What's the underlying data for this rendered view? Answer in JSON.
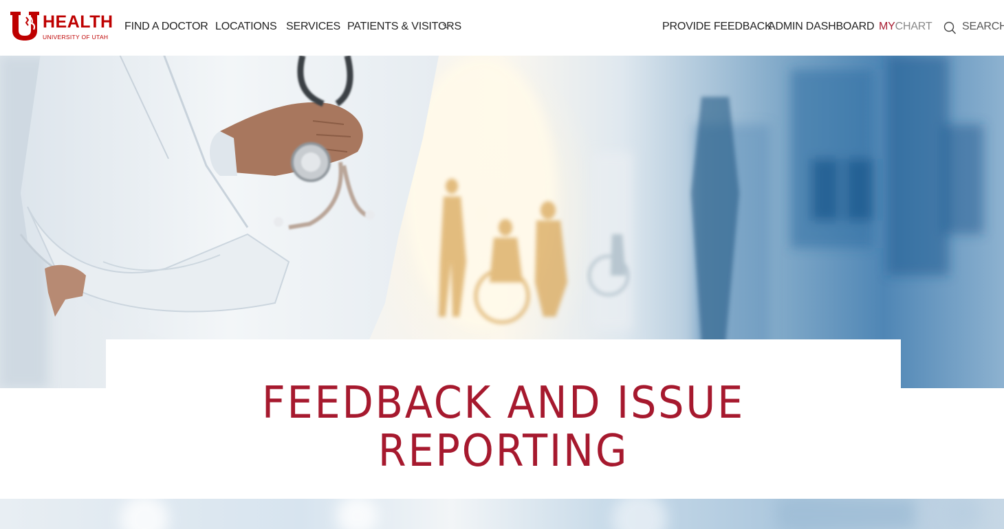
{
  "logo": {
    "brand": "HEALTH",
    "subtitle": "UNIVERSITY OF UTAH",
    "brand_color": "#be0000"
  },
  "nav": {
    "primary": [
      {
        "label": "FIND A DOCTOR"
      },
      {
        "label": "LOCATIONS"
      },
      {
        "label": "SERVICES"
      },
      {
        "label": "PATIENTS & VISITORS",
        "icon": "chevron-down-icon"
      }
    ],
    "secondary": {
      "feedback": "PROVIDE FEEDBACK",
      "admin": "ADMIN DASHBOARD",
      "mychart_my": "MY",
      "mychart_chart": "CHART",
      "search": "SEARCH"
    }
  },
  "hero": {
    "image": "doctor-with-stethoscope-hospital-hallway"
  },
  "page": {
    "title": "FEEDBACK AND ISSUE REPORTING"
  },
  "colors": {
    "accent": "#a6192e",
    "nav_text": "#222222",
    "muted": "#888888"
  }
}
